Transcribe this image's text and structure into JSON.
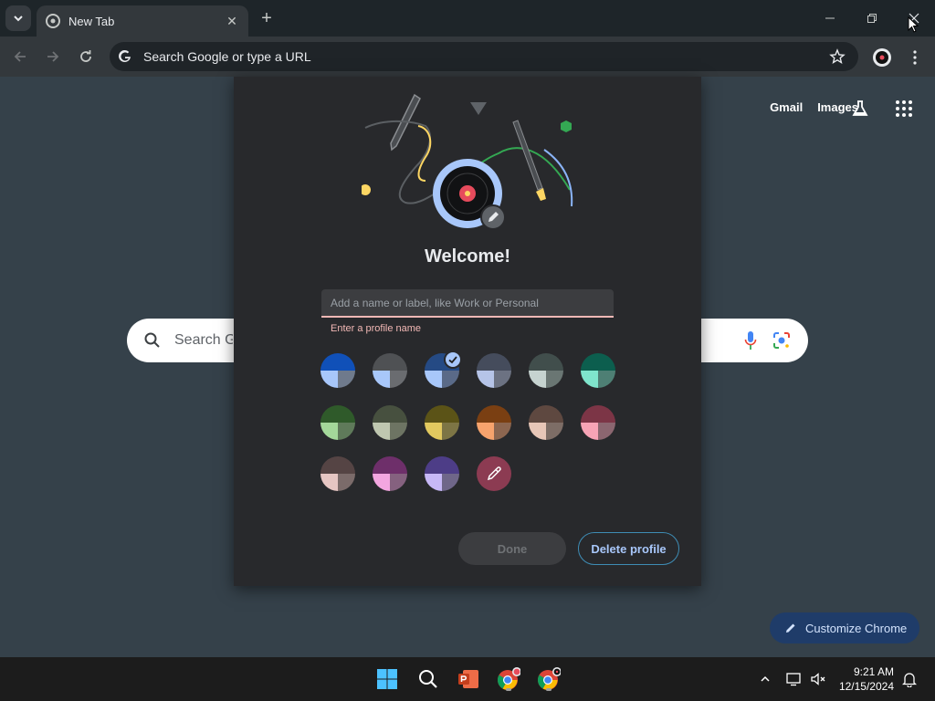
{
  "browser": {
    "tab_title": "New Tab",
    "omnibox_text": "Search Google or type a URL"
  },
  "page": {
    "links": {
      "gmail": "Gmail",
      "images": "Images"
    },
    "search_placeholder": "Search Google or type a URL",
    "search_visible": "Search G",
    "customize_label": "Customize Chrome"
  },
  "dialog": {
    "heading": "Welcome!",
    "name_placeholder": "Add a name or label, like Work or Personal",
    "name_value": "",
    "hint": "Enter a profile name",
    "selected_theme_index": 2,
    "themes": [
      {
        "tl": "#1050b8",
        "tr": "#1050b8",
        "bl": "#a8c7fa",
        "br": "#6f7a8c"
      },
      {
        "tl": "#4f5154",
        "tr": "#4f5154",
        "bl": "#a8c7fa",
        "br": "#6a6c70"
      },
      {
        "tl": "#254a84",
        "tr": "#254a84",
        "bl": "#a8c7fa",
        "br": "#5a6a88"
      },
      {
        "tl": "#454c5c",
        "tr": "#454c5c",
        "bl": "#b6c4e8",
        "br": "#6c7282"
      },
      {
        "tl": "#414e4c",
        "tr": "#414e4c",
        "bl": "#c6d3d0",
        "br": "#6a7673"
      },
      {
        "tl": "#0c5e4e",
        "tr": "#0c5e4e",
        "bl": "#7fe5cc",
        "br": "#4e7f74"
      },
      {
        "tl": "#2f5a2a",
        "tr": "#2f5a2a",
        "bl": "#a4d89a",
        "br": "#5f7a5a"
      },
      {
        "tl": "#47503f",
        "tr": "#47503f",
        "bl": "#bfc7b0",
        "br": "#6d7463"
      },
      {
        "tl": "#5b5317",
        "tr": "#5b5317",
        "bl": "#e2c95f",
        "br": "#7d7545"
      },
      {
        "tl": "#7a3f12",
        "tr": "#7a3f12",
        "bl": "#f7a36d",
        "br": "#8c6650"
      },
      {
        "tl": "#5e4840",
        "tr": "#5e4840",
        "bl": "#e7c6b7",
        "br": "#7d6d66"
      },
      {
        "tl": "#7c3546",
        "tr": "#7c3546",
        "bl": "#f7a4b6",
        "br": "#8b6670"
      },
      {
        "tl": "#554444",
        "tr": "#554444",
        "bl": "#e6c6c3",
        "br": "#7b6b6a"
      },
      {
        "tl": "#6e2f6a",
        "tr": "#6e2f6a",
        "bl": "#f3a6e0",
        "br": "#85617f"
      },
      {
        "tl": "#4d3d87",
        "tr": "#4d3d87",
        "bl": "#c7b8f7",
        "br": "#6f6689"
      }
    ],
    "done_label": "Done",
    "delete_label": "Delete profile"
  },
  "taskbar": {
    "time": "9:21 AM",
    "date": "12/15/2024"
  }
}
